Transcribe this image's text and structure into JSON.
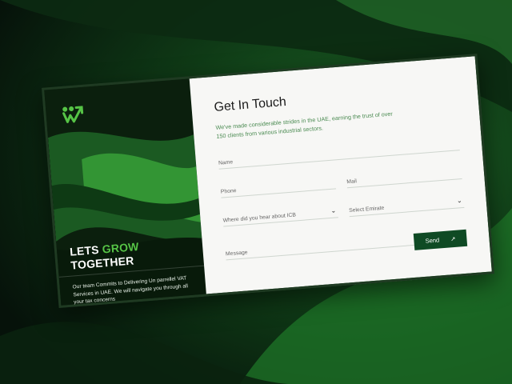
{
  "left_panel": {
    "headline_line1_prefix": "LETS ",
    "headline_line1_accent": "GROW",
    "headline_line2": "TOGETHER",
    "blurb": "Our team Commits to Delivering Un parrellel VAT Services in UAE. We will navigate you through all your tax concerns"
  },
  "form": {
    "title": "Get In Touch",
    "subtitle": "We've made considerable strides in the UAE, earning the trust of over 150 clients from various industrial sectors.",
    "name_placeholder": "Name",
    "phone_placeholder": "Phone",
    "mail_placeholder": "Mail",
    "hear_placeholder": "Where did you hear about ICB",
    "emirate_placeholder": "Select Emirate",
    "message_placeholder": "Message",
    "send_label": "Send",
    "send_icon": "arrow-up-right-icon"
  },
  "colors": {
    "accent": "#56c446",
    "button": "#0f4a24",
    "subtitle": "#4b8b52"
  }
}
